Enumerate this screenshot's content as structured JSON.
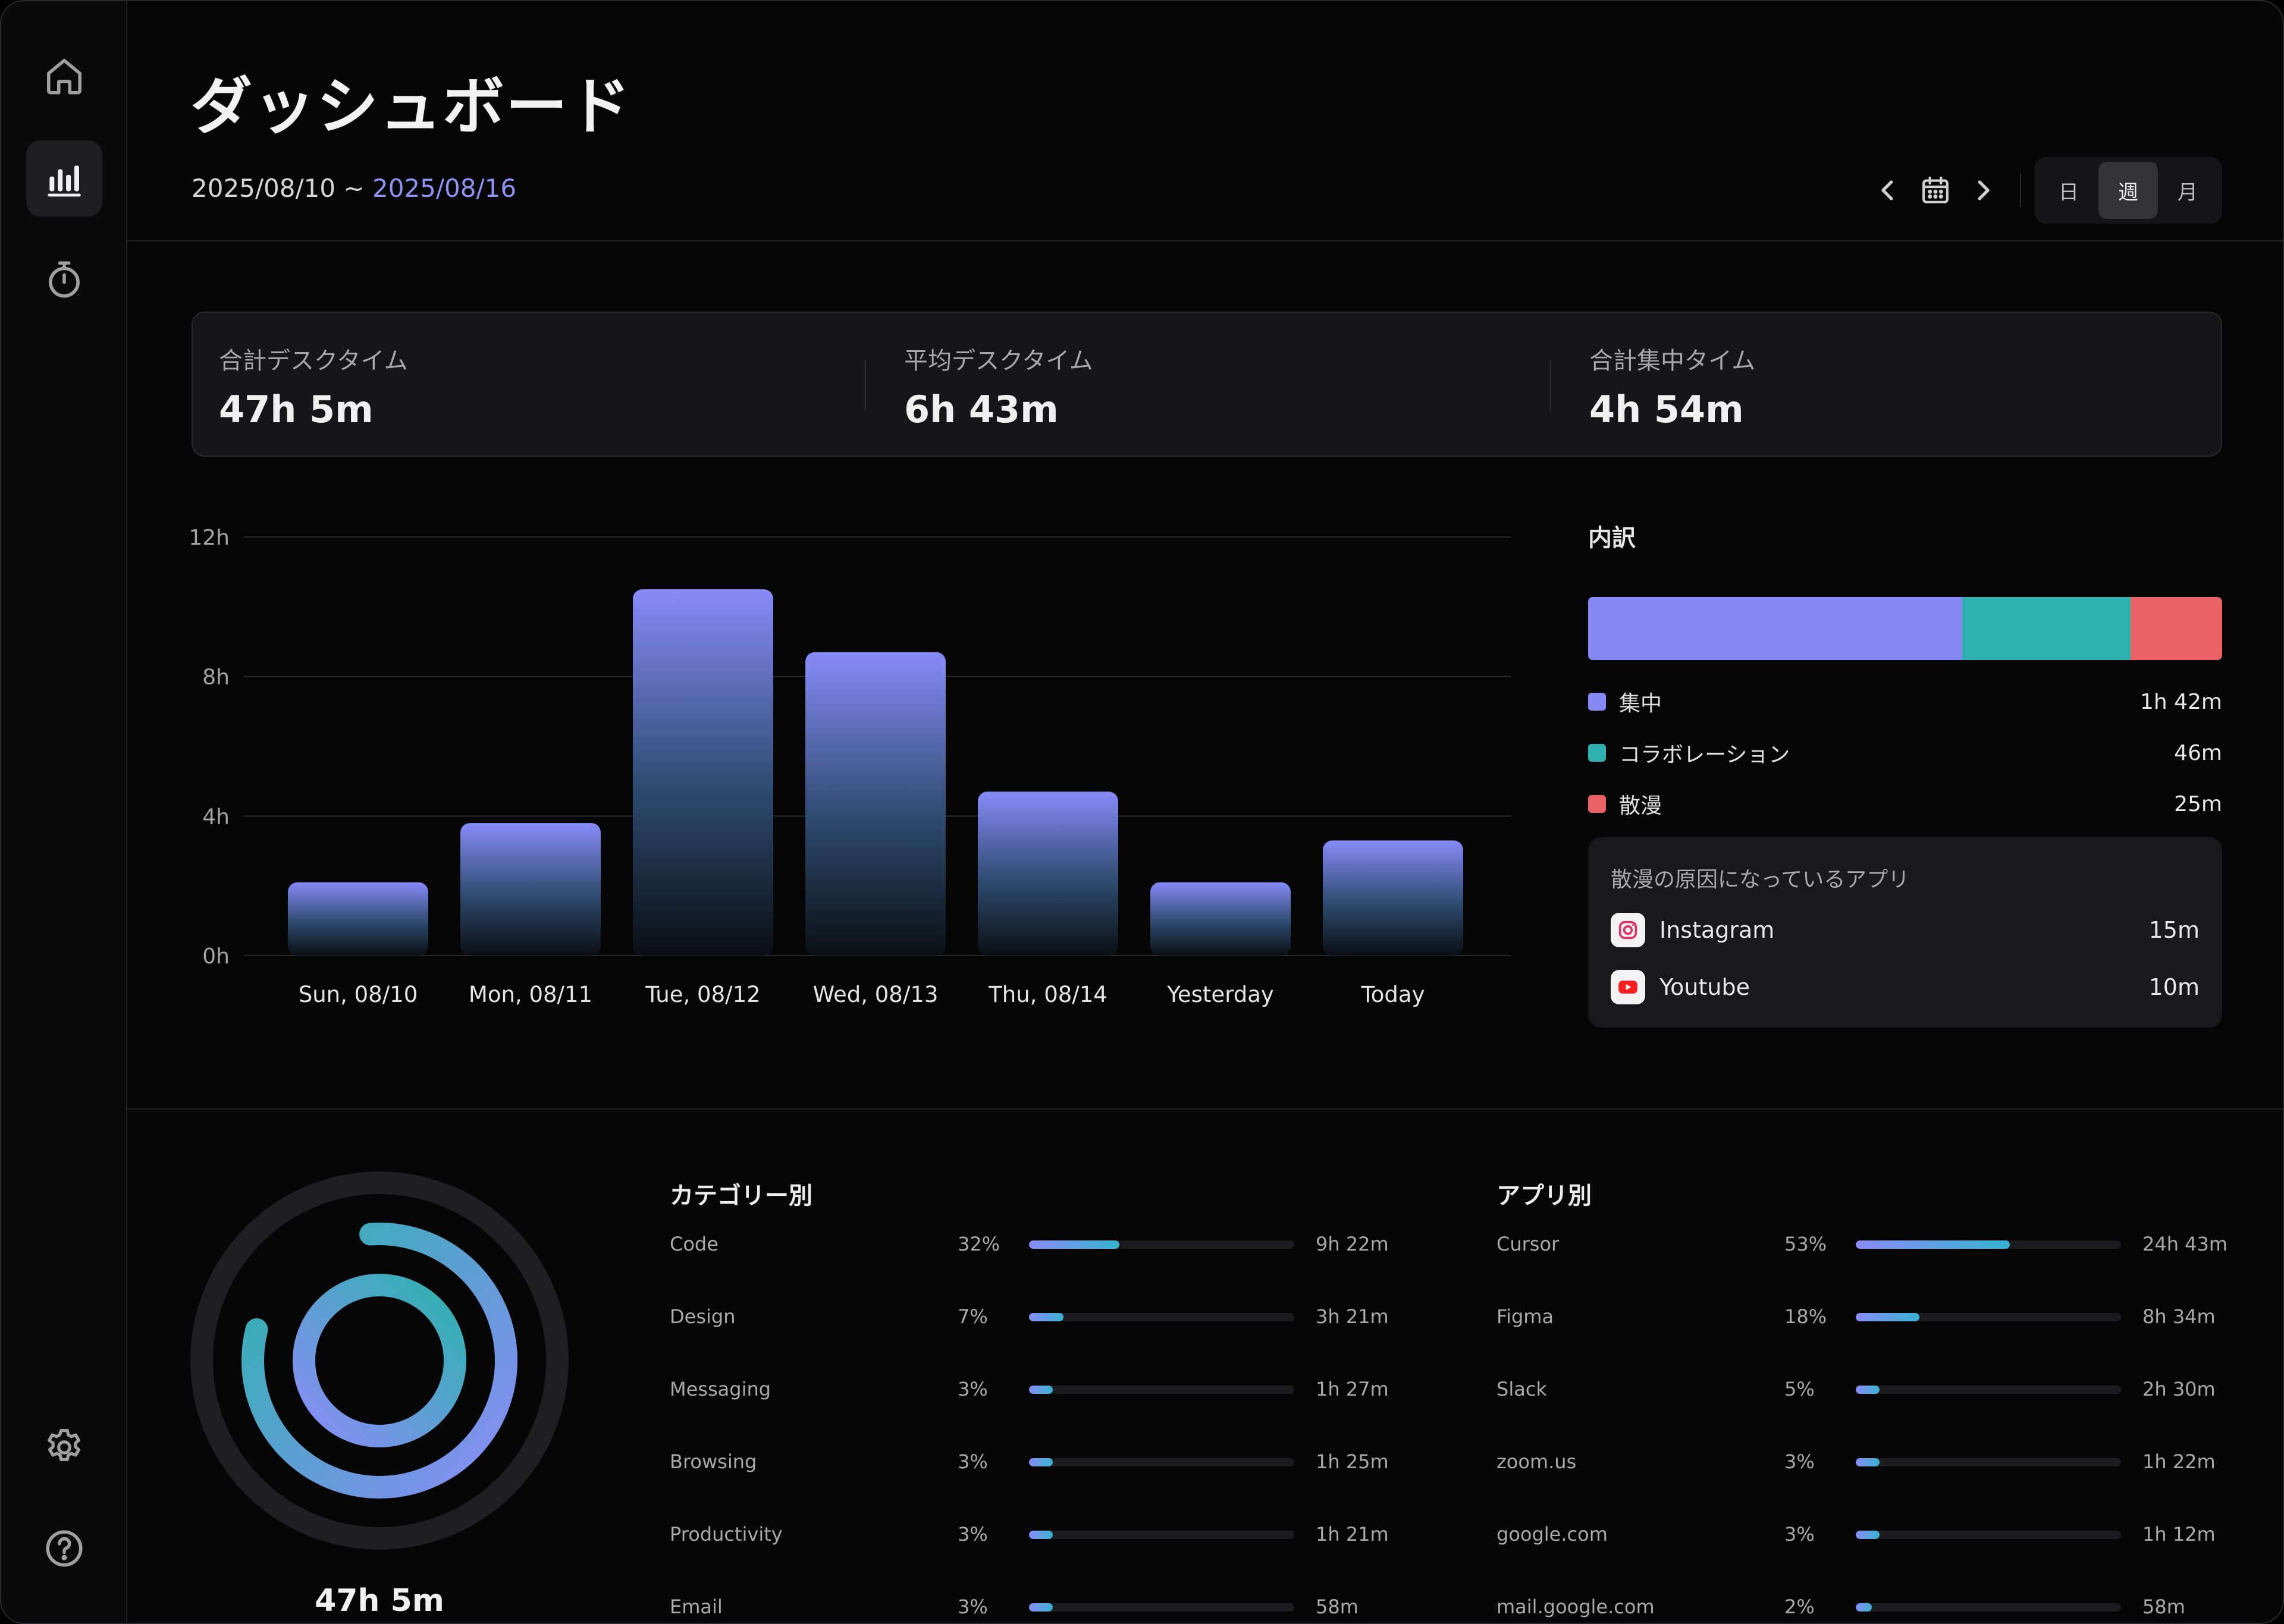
{
  "sidebar": {
    "items": [
      {
        "name": "home",
        "icon": "home-icon",
        "active": false
      },
      {
        "name": "dashboard",
        "icon": "bar-chart-icon",
        "active": true
      },
      {
        "name": "timer",
        "icon": "stopwatch-icon",
        "active": false
      }
    ],
    "bottom": [
      {
        "name": "settings",
        "icon": "gear-icon"
      },
      {
        "name": "help",
        "icon": "help-circle-icon"
      }
    ]
  },
  "header": {
    "title": "ダッシュボード",
    "date_start": "2025/08/10",
    "date_sep": " ~ ",
    "date_end": "2025/08/16",
    "period_options": [
      "日",
      "週",
      "月"
    ],
    "period_selected": "週"
  },
  "stats": [
    {
      "label": "合計デスクタイム",
      "value": "47h 5m"
    },
    {
      "label": "平均デスクタイム",
      "value": "6h 43m"
    },
    {
      "label": "合計集中タイム",
      "value": "4h 54m"
    }
  ],
  "chart_data": {
    "type": "bar",
    "categories": [
      "Sun, 08/10",
      "Mon, 08/11",
      "Tue, 08/12",
      "Wed, 08/13",
      "Thu, 08/14",
      "Yesterday",
      "Today"
    ],
    "values": [
      2.1,
      3.8,
      10.5,
      8.7,
      4.7,
      2.1,
      3.3
    ],
    "yticks": [
      "0h",
      "4h",
      "8h",
      "12h"
    ],
    "ylim": [
      0,
      12
    ],
    "grid": true
  },
  "breakdown": {
    "title": "内訳",
    "items": [
      {
        "label": "集中",
        "value": "1h 42m",
        "minutes": 102,
        "color": "#8688f6"
      },
      {
        "label": "コラボレーション",
        "value": "46m",
        "minutes": 46,
        "color": "#2eb1ae"
      },
      {
        "label": "散漫",
        "value": "25m",
        "minutes": 25,
        "color": "#ea6166"
      }
    ],
    "distraction_title": "散漫の原因になっているアプリ",
    "distraction_apps": [
      {
        "name": "Instagram",
        "value": "15m",
        "icon": "instagram-icon"
      },
      {
        "name": "Youtube",
        "value": "10m",
        "icon": "youtube-icon"
      }
    ]
  },
  "summary": {
    "total": "47h 5m"
  },
  "categories": {
    "title": "カテゴリー別",
    "rows": [
      {
        "name": "Code",
        "pct": "32%",
        "fill": 0.34,
        "dur": "9h 22m"
      },
      {
        "name": "Design",
        "pct": "7%",
        "fill": 0.13,
        "dur": "3h 21m"
      },
      {
        "name": "Messaging",
        "pct": "3%",
        "fill": 0.09,
        "dur": "1h 27m"
      },
      {
        "name": "Browsing",
        "pct": "3%",
        "fill": 0.09,
        "dur": "1h 25m"
      },
      {
        "name": "Productivity",
        "pct": "3%",
        "fill": 0.09,
        "dur": "1h 21m"
      },
      {
        "name": "Email",
        "pct": "3%",
        "fill": 0.09,
        "dur": "58m"
      }
    ]
  },
  "apps": {
    "title": "アプリ別",
    "rows": [
      {
        "name": "Cursor",
        "pct": "53%",
        "fill": 0.58,
        "dur": "24h 43m"
      },
      {
        "name": "Figma",
        "pct": "18%",
        "fill": 0.24,
        "dur": "8h 34m"
      },
      {
        "name": "Slack",
        "pct": "5%",
        "fill": 0.09,
        "dur": "2h 30m"
      },
      {
        "name": "zoom.us",
        "pct": "3%",
        "fill": 0.09,
        "dur": "1h 22m"
      },
      {
        "name": "google.com",
        "pct": "3%",
        "fill": 0.09,
        "dur": "1h 12m"
      },
      {
        "name": "mail.google.com",
        "pct": "2%",
        "fill": 0.06,
        "dur": "58m"
      }
    ]
  }
}
